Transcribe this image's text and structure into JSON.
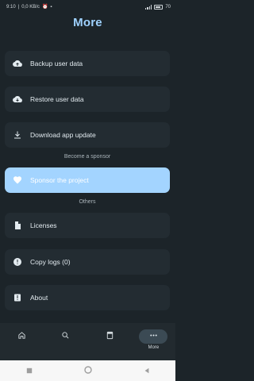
{
  "status_bar": {
    "time": "9:10",
    "network_speed": "0,0 KB/c",
    "battery": "70"
  },
  "header": {
    "title": "More"
  },
  "items": [
    {
      "label": "Backup user data",
      "icon": "cloud-upload-icon"
    },
    {
      "label": "Restore user data",
      "icon": "cloud-download-icon"
    },
    {
      "label": "Download app update",
      "icon": "download-icon"
    },
    {
      "label": "Sponsor the project",
      "icon": "heart-icon"
    },
    {
      "label": "Licenses",
      "icon": "document-icon"
    },
    {
      "label": "Copy logs (0)",
      "icon": "info-icon"
    },
    {
      "label": "About",
      "icon": "info-box-icon"
    }
  ],
  "sections": {
    "sponsor": "Become a sponsor",
    "others": "Others"
  },
  "bottom_nav": {
    "items": [
      {
        "icon": "home-icon"
      },
      {
        "icon": "search-icon"
      },
      {
        "icon": "book-icon"
      },
      {
        "icon": "more-icon",
        "label": "More",
        "active": true
      }
    ]
  },
  "colors": {
    "background": "#1c2429",
    "card": "#232c32",
    "accent": "#9fd2ff",
    "active_card": "#a3d4ff"
  }
}
